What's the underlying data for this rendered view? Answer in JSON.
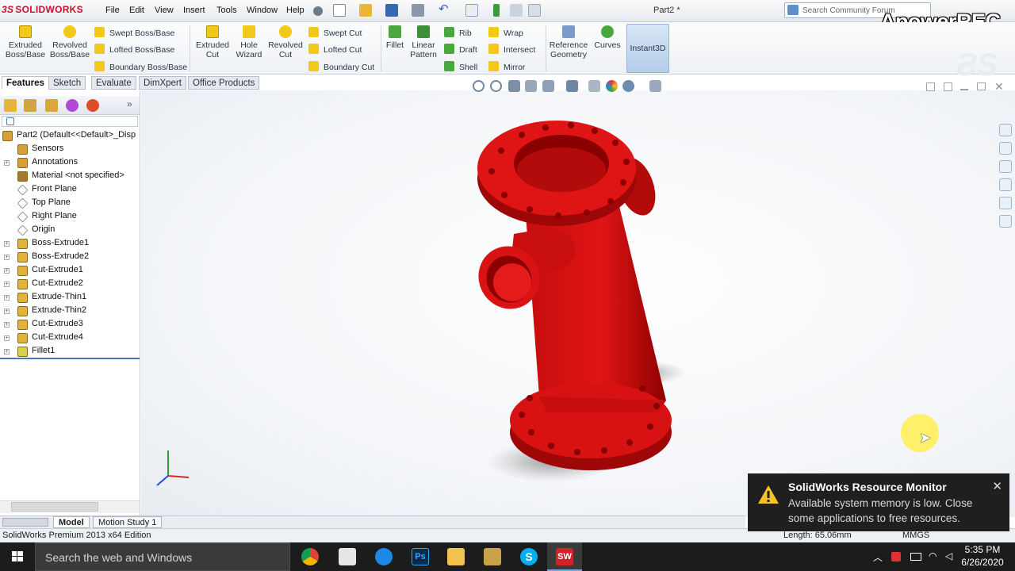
{
  "app": {
    "brand_ds": "3S",
    "brand_name": "SOLIDWORKS",
    "document_title": "Part2 *",
    "watermark": "ApowerREC"
  },
  "menu": [
    "File",
    "Edit",
    "View",
    "Insert",
    "Tools",
    "Window",
    "Help"
  ],
  "search": {
    "placeholder": "Search Community Forum"
  },
  "ribbon": {
    "extruded_boss": "Extruded Boss/Base",
    "revolved_boss": "Revolved Boss/Base",
    "swept_boss": "Swept Boss/Base",
    "lofted_boss": "Lofted Boss/Base",
    "boundary_boss": "Boundary Boss/Base",
    "extruded_cut": "Extruded Cut",
    "hole_wizard": "Hole Wizard",
    "revolved_cut": "Revolved Cut",
    "swept_cut": "Swept Cut",
    "lofted_cut": "Lofted Cut",
    "boundary_cut": "Boundary Cut",
    "fillet": "Fillet",
    "linear_pattern": "Linear Pattern",
    "rib": "Rib",
    "draft": "Draft",
    "shell": "Shell",
    "wrap": "Wrap",
    "intersect": "Intersect",
    "mirror": "Mirror",
    "reference_geometry": "Reference Geometry",
    "curves": "Curves",
    "instant3d": "Instant3D"
  },
  "tabs": [
    "Features",
    "Sketch",
    "Evaluate",
    "DimXpert",
    "Office Products"
  ],
  "tree": {
    "root": "Part2  (Default<<Default>_Disp",
    "items": [
      "Sensors",
      "Annotations",
      "Material <not specified>",
      "Front Plane",
      "Top Plane",
      "Right Plane",
      "Origin",
      "Boss-Extrude1",
      "Boss-Extrude2",
      "Cut-Extrude1",
      "Cut-Extrude2",
      "Extrude-Thin1",
      "Extrude-Thin2",
      "Cut-Extrude3",
      "Cut-Extrude4",
      "Fillet1"
    ]
  },
  "bottom_tabs": [
    "Model",
    "Motion Study 1"
  ],
  "status": {
    "edition": "SolidWorks Premium 2013 x64 Edition",
    "length": "Length: 65.06mm",
    "units": "MMGS"
  },
  "notification": {
    "title": "SolidWorks Resource Monitor",
    "message": "Available system memory is low. Close some applications to free resources."
  },
  "taskbar": {
    "search_text": "Search the web and Windows",
    "time": "5:35 PM",
    "date": "6/26/2020"
  },
  "colors": {
    "part_red": "#d50f0f",
    "part_dark": "#8e0000",
    "accent": "#c8102e"
  }
}
